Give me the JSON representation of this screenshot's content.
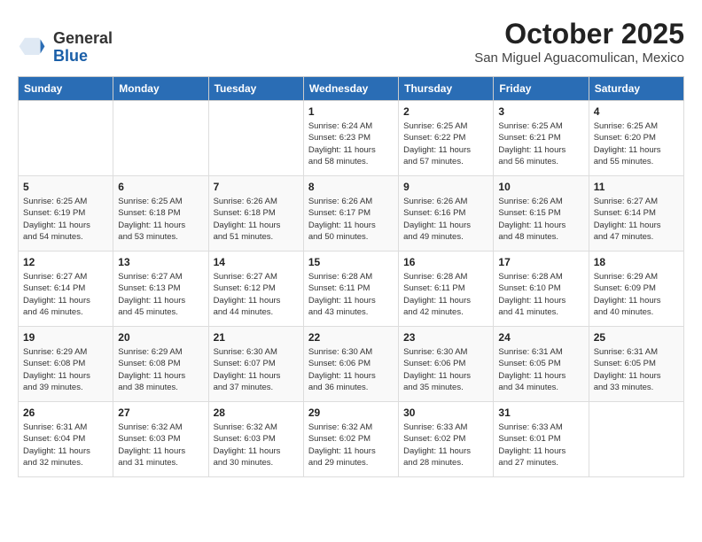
{
  "header": {
    "logo_general": "General",
    "logo_blue": "Blue",
    "month_title": "October 2025",
    "location": "San Miguel Aguacomulican, Mexico"
  },
  "weekdays": [
    "Sunday",
    "Monday",
    "Tuesday",
    "Wednesday",
    "Thursday",
    "Friday",
    "Saturday"
  ],
  "weeks": [
    [
      {
        "day": "",
        "info": ""
      },
      {
        "day": "",
        "info": ""
      },
      {
        "day": "",
        "info": ""
      },
      {
        "day": "1",
        "info": "Sunrise: 6:24 AM\nSunset: 6:23 PM\nDaylight: 11 hours\nand 58 minutes."
      },
      {
        "day": "2",
        "info": "Sunrise: 6:25 AM\nSunset: 6:22 PM\nDaylight: 11 hours\nand 57 minutes."
      },
      {
        "day": "3",
        "info": "Sunrise: 6:25 AM\nSunset: 6:21 PM\nDaylight: 11 hours\nand 56 minutes."
      },
      {
        "day": "4",
        "info": "Sunrise: 6:25 AM\nSunset: 6:20 PM\nDaylight: 11 hours\nand 55 minutes."
      }
    ],
    [
      {
        "day": "5",
        "info": "Sunrise: 6:25 AM\nSunset: 6:19 PM\nDaylight: 11 hours\nand 54 minutes."
      },
      {
        "day": "6",
        "info": "Sunrise: 6:25 AM\nSunset: 6:18 PM\nDaylight: 11 hours\nand 53 minutes."
      },
      {
        "day": "7",
        "info": "Sunrise: 6:26 AM\nSunset: 6:18 PM\nDaylight: 11 hours\nand 51 minutes."
      },
      {
        "day": "8",
        "info": "Sunrise: 6:26 AM\nSunset: 6:17 PM\nDaylight: 11 hours\nand 50 minutes."
      },
      {
        "day": "9",
        "info": "Sunrise: 6:26 AM\nSunset: 6:16 PM\nDaylight: 11 hours\nand 49 minutes."
      },
      {
        "day": "10",
        "info": "Sunrise: 6:26 AM\nSunset: 6:15 PM\nDaylight: 11 hours\nand 48 minutes."
      },
      {
        "day": "11",
        "info": "Sunrise: 6:27 AM\nSunset: 6:14 PM\nDaylight: 11 hours\nand 47 minutes."
      }
    ],
    [
      {
        "day": "12",
        "info": "Sunrise: 6:27 AM\nSunset: 6:14 PM\nDaylight: 11 hours\nand 46 minutes."
      },
      {
        "day": "13",
        "info": "Sunrise: 6:27 AM\nSunset: 6:13 PM\nDaylight: 11 hours\nand 45 minutes."
      },
      {
        "day": "14",
        "info": "Sunrise: 6:27 AM\nSunset: 6:12 PM\nDaylight: 11 hours\nand 44 minutes."
      },
      {
        "day": "15",
        "info": "Sunrise: 6:28 AM\nSunset: 6:11 PM\nDaylight: 11 hours\nand 43 minutes."
      },
      {
        "day": "16",
        "info": "Sunrise: 6:28 AM\nSunset: 6:11 PM\nDaylight: 11 hours\nand 42 minutes."
      },
      {
        "day": "17",
        "info": "Sunrise: 6:28 AM\nSunset: 6:10 PM\nDaylight: 11 hours\nand 41 minutes."
      },
      {
        "day": "18",
        "info": "Sunrise: 6:29 AM\nSunset: 6:09 PM\nDaylight: 11 hours\nand 40 minutes."
      }
    ],
    [
      {
        "day": "19",
        "info": "Sunrise: 6:29 AM\nSunset: 6:08 PM\nDaylight: 11 hours\nand 39 minutes."
      },
      {
        "day": "20",
        "info": "Sunrise: 6:29 AM\nSunset: 6:08 PM\nDaylight: 11 hours\nand 38 minutes."
      },
      {
        "day": "21",
        "info": "Sunrise: 6:30 AM\nSunset: 6:07 PM\nDaylight: 11 hours\nand 37 minutes."
      },
      {
        "day": "22",
        "info": "Sunrise: 6:30 AM\nSunset: 6:06 PM\nDaylight: 11 hours\nand 36 minutes."
      },
      {
        "day": "23",
        "info": "Sunrise: 6:30 AM\nSunset: 6:06 PM\nDaylight: 11 hours\nand 35 minutes."
      },
      {
        "day": "24",
        "info": "Sunrise: 6:31 AM\nSunset: 6:05 PM\nDaylight: 11 hours\nand 34 minutes."
      },
      {
        "day": "25",
        "info": "Sunrise: 6:31 AM\nSunset: 6:05 PM\nDaylight: 11 hours\nand 33 minutes."
      }
    ],
    [
      {
        "day": "26",
        "info": "Sunrise: 6:31 AM\nSunset: 6:04 PM\nDaylight: 11 hours\nand 32 minutes."
      },
      {
        "day": "27",
        "info": "Sunrise: 6:32 AM\nSunset: 6:03 PM\nDaylight: 11 hours\nand 31 minutes."
      },
      {
        "day": "28",
        "info": "Sunrise: 6:32 AM\nSunset: 6:03 PM\nDaylight: 11 hours\nand 30 minutes."
      },
      {
        "day": "29",
        "info": "Sunrise: 6:32 AM\nSunset: 6:02 PM\nDaylight: 11 hours\nand 29 minutes."
      },
      {
        "day": "30",
        "info": "Sunrise: 6:33 AM\nSunset: 6:02 PM\nDaylight: 11 hours\nand 28 minutes."
      },
      {
        "day": "31",
        "info": "Sunrise: 6:33 AM\nSunset: 6:01 PM\nDaylight: 11 hours\nand 27 minutes."
      },
      {
        "day": "",
        "info": ""
      }
    ]
  ]
}
